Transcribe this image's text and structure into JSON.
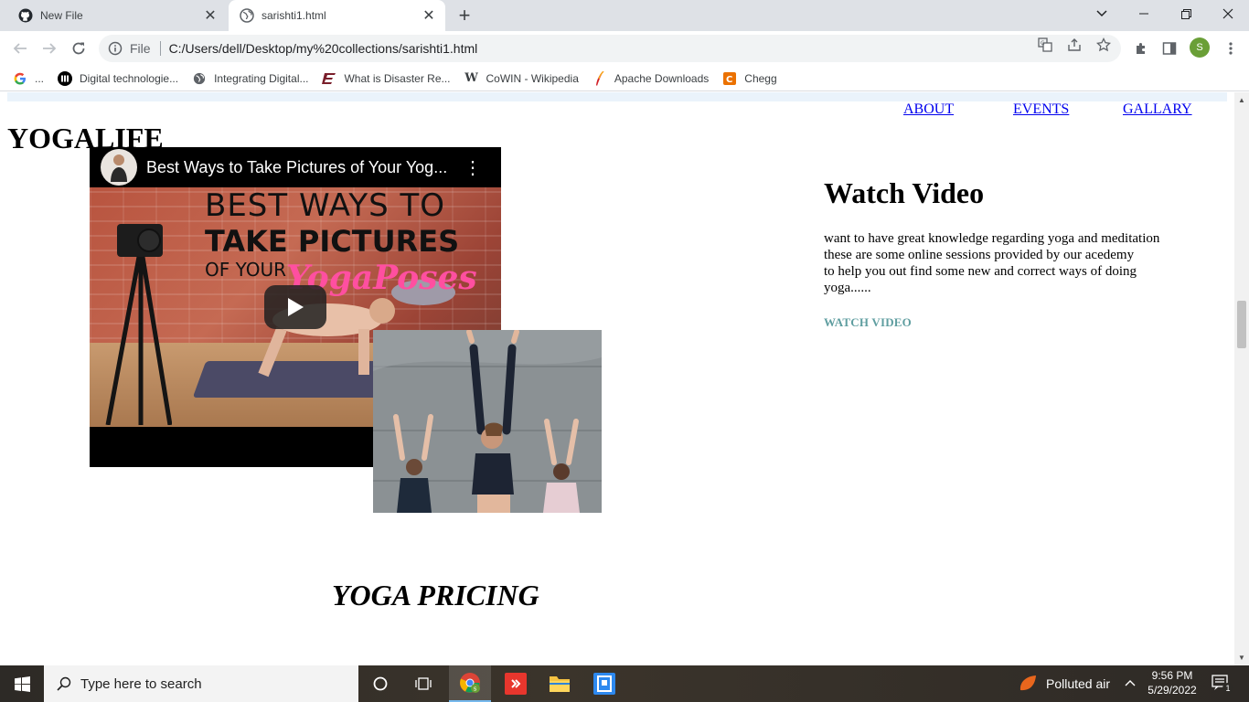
{
  "browser": {
    "tabs": [
      {
        "title": "New File",
        "icon": "github-icon",
        "active": false
      },
      {
        "title": "sarishti1.html",
        "icon": "globe-icon",
        "active": true
      }
    ],
    "address": {
      "scheme_label": "File",
      "url": "C:/Users/dell/Desktop/my%20collections/sarishti1.html"
    },
    "profile_initial": "S",
    "bookmarks": [
      {
        "label": "...",
        "icon": "google-icon"
      },
      {
        "label": "Digital technologie...",
        "icon": "medium-icon"
      },
      {
        "label": "Integrating Digital...",
        "icon": "globe-icon"
      },
      {
        "label": "What is Disaster Re...",
        "icon": "e-logo-icon"
      },
      {
        "label": "CoWIN - Wikipedia",
        "icon": "wikipedia-icon"
      },
      {
        "label": "Apache Downloads",
        "icon": "apache-feather-icon"
      },
      {
        "label": "Chegg",
        "icon": "chegg-icon"
      }
    ]
  },
  "page": {
    "nav": [
      "ABOUT",
      "EVENTS",
      "GALLARY"
    ],
    "logo": "YOGALIFE",
    "video": {
      "title": "Best Ways to Take Pictures of Your Yog...",
      "thumb_line1": "BEST WAYS TO",
      "thumb_line2": "TAKE PICTURES",
      "thumb_line3": "OF YOUR",
      "thumb_line4": "YogaPoses"
    },
    "watch": {
      "heading": "Watch Video",
      "line1": "want to have great knowledge regarding yoga and meditation",
      "line2": "these are some online sessions provided by our acedemy",
      "line3": "to help you out find some new and correct ways of doing",
      "line4": "yoga......",
      "link": "WATCH VIDEO"
    },
    "pricing_heading": "YOGA PRICING",
    "link_color": "#0000ee",
    "accent_link_color": "#5f9ea0"
  },
  "taskbar": {
    "search_placeholder": "Type here to search",
    "weather": "Polluted air",
    "time": "9:56 PM",
    "date": "5/29/2022",
    "notification_count": "1"
  }
}
